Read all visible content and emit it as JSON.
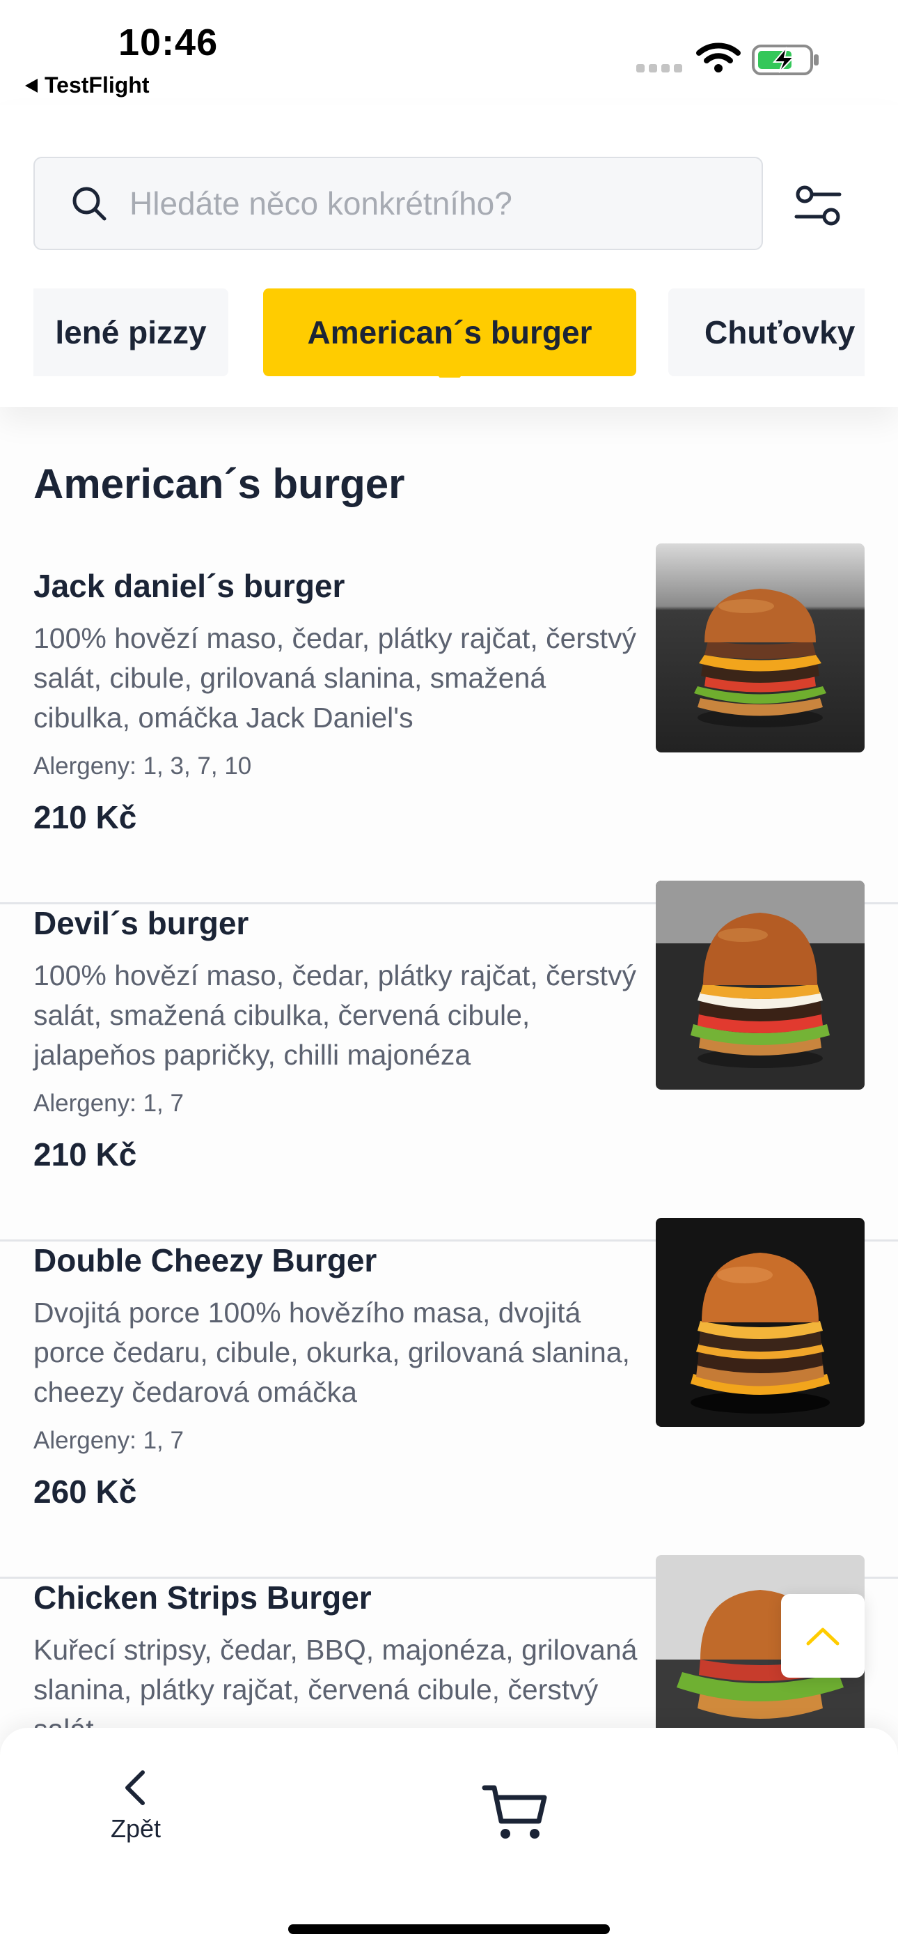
{
  "status_bar": {
    "time": "10:46",
    "back_app": "TestFlight"
  },
  "search": {
    "placeholder": "Hledáte něco konkrétního?",
    "icon": "search-icon"
  },
  "filter": {
    "icon": "sliders-icon"
  },
  "categories": [
    {
      "label": "lené pizzy",
      "active": false
    },
    {
      "label": "American´s burger",
      "active": true
    },
    {
      "label": "Chuťovky",
      "active": false
    }
  ],
  "colors": {
    "accent": "#ffcc00",
    "text": "#1b2436",
    "muted": "#5c6270"
  },
  "section_title": "American´s burger",
  "items": [
    {
      "name": "Jack daniel´s burger",
      "description": "100% hovězí maso, čedar, plátky rajčat, čerstvý salát, cibule, grilovaná slanina, smažená cibulka, omáčka Jack Daniel's",
      "allergens": "Alergeny: 1, 3, 7, 10",
      "price": "210 Kč"
    },
    {
      "name": "Devil´s burger",
      "description": "100% hovězí maso, čedar, plátky rajčat, čerstvý salát, smažená cibulka, červená cibule, jalapeňos papričky, chilli majonéza",
      "allergens": "Alergeny: 1, 7",
      "price": "210 Kč"
    },
    {
      "name": "Double Cheezy Burger",
      "description": "Dvojitá porce 100% hovězího masa, dvojitá porce čedaru, cibule, okurka, grilovaná slanina, cheezy čedarová omáčka",
      "allergens": "Alergeny: 1, 7",
      "price": "260 Kč"
    },
    {
      "name": "Chicken Strips Burger",
      "description": "Kuřecí stripsy, čedar, BBQ, majonéza, grilovaná slanina, plátky rajčat, červená cibule, čerstvý salát",
      "allergens": "",
      "price": ""
    }
  ],
  "bottom_nav": {
    "back_label": "Zpět",
    "back_icon": "chevron-left-icon",
    "cart_icon": "cart-icon"
  }
}
